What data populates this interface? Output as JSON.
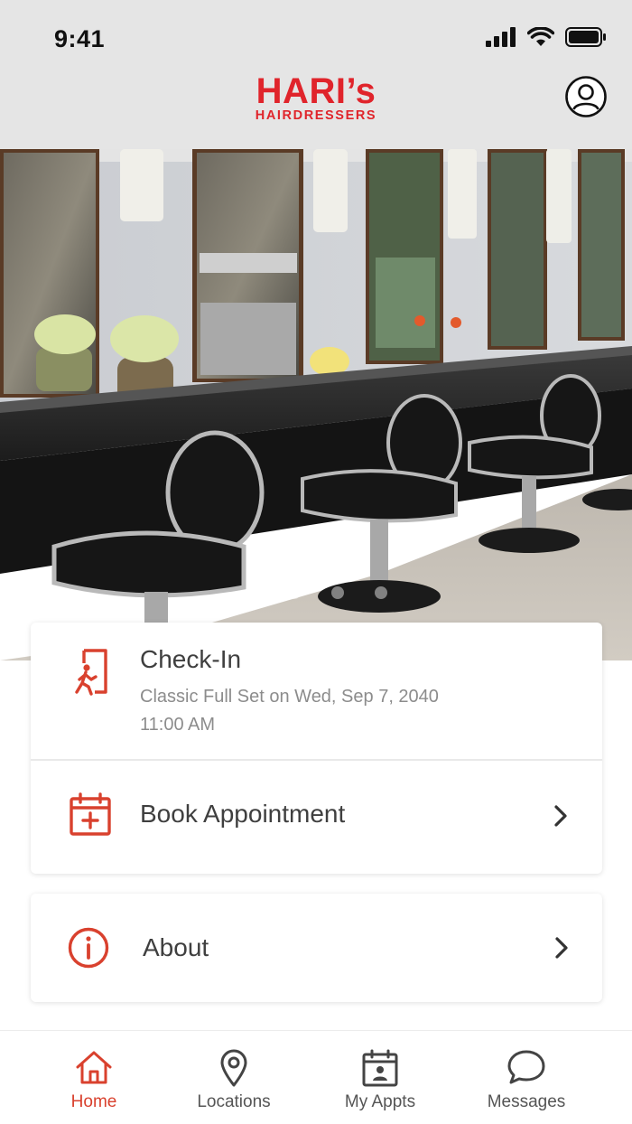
{
  "status_bar": {
    "time": "9:41"
  },
  "header": {
    "logo_main": "HARI’s",
    "logo_sub": "HAIRDRESSERS",
    "profile_icon": "user-circle-icon"
  },
  "hero": {
    "slide_count": 4,
    "active_slide": 1
  },
  "checkin": {
    "title": "Check-In",
    "detail_line1": "Classic Full Set on Wed, Sep 7, 2040",
    "detail_line2": "11:00 AM",
    "icon": "door-walk-in-icon"
  },
  "book": {
    "title": "Book Appointment",
    "icon": "calendar-plus-icon"
  },
  "about": {
    "title": "About",
    "icon": "info-circle-icon"
  },
  "tabs": [
    {
      "label": "Home",
      "icon": "home-icon",
      "active": true
    },
    {
      "label": "Locations",
      "icon": "map-pin-icon",
      "active": false
    },
    {
      "label": "My Appts",
      "icon": "calendar-person-icon",
      "active": false
    },
    {
      "label": "Messages",
      "icon": "chat-bubble-icon",
      "active": false
    }
  ],
  "colors": {
    "accent": "#e0242b",
    "icon_red": "#d9412e",
    "header_bg": "#e5e5e5"
  }
}
